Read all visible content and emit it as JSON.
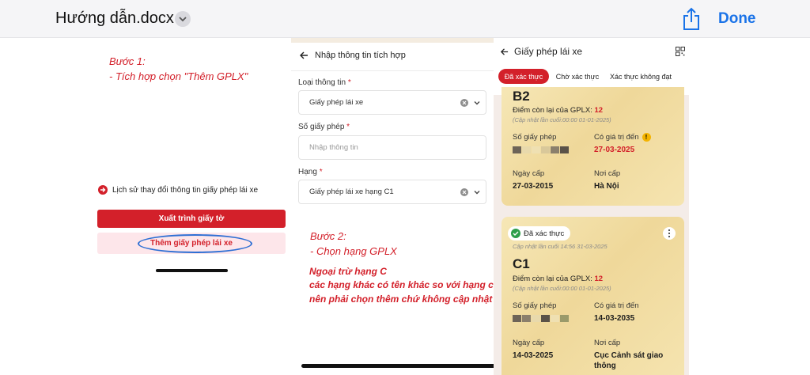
{
  "topbar": {
    "doc_title": "Hướng dẫn.docx",
    "done_label": "Done"
  },
  "left": {
    "step1_title": "Bước 1:",
    "step1_desc": "- Tích hợp chọn \"Thêm GPLX\"",
    "history_label": "Lịch sử thay đổi thông tin giấy phép lái xe",
    "export_button": "Xuất trình giấy tờ",
    "add_button": "Thêm giấy phép lái xe"
  },
  "middle": {
    "header_title": "Nhập thông tin tích hợp",
    "fields": [
      {
        "label": "Loại thông tin",
        "value": "Giấy phép lái xe",
        "placeholder": ""
      },
      {
        "label": "Số giấy phép",
        "value": "",
        "placeholder": "Nhập thông tin"
      },
      {
        "label": "Hạng",
        "value": "Giấy phép lái xe hạng C1",
        "placeholder": ""
      }
    ],
    "required_mark": "*",
    "step2_title": "Bước 2:",
    "step2_desc": "- Chọn hạng GPLX",
    "notes": [
      "Ngoại trừ hạng C",
      "các hạng khác có tên khác so với hạng cũ",
      "nên phải chọn thêm chứ không cập nhật"
    ]
  },
  "right": {
    "header_title": "Giấy phép lái xe",
    "tabs": [
      "Đã xác thực",
      "Chờ xác thực",
      "Xác thực không đạt"
    ],
    "cards": [
      {
        "license_class": "B2",
        "points_label": "Điểm còn lại của GPLX:",
        "points": "12",
        "updated": "(Cập nhật lần cuối:00:00 01-01-2025)",
        "number_label": "Số giấy phép",
        "valid_label": "Có giá trị đến",
        "valid_value": "27-03-2025",
        "issue_label": "Ngày cấp",
        "issue_value": "27-03-2015",
        "place_label": "Nơi cấp",
        "place_value": "Hà Nội"
      },
      {
        "badge": "Đã xác thực",
        "updated_top": "Cập nhật lần cuối 14:56 31-03-2025",
        "license_class": "C1",
        "points_label": "Điểm còn lại của GPLX:",
        "points": "12",
        "updated": "(Cập nhật lần cuối:00:00 01-01-2025)",
        "number_label": "Số giấy phép",
        "valid_label": "Có giá trị đến",
        "valid_value": "14-03-2035",
        "issue_label": "Ngày cấp",
        "issue_value": "14-03-2025",
        "place_label": "Nơi cấp",
        "place_value_1": "Cục Cảnh sát giao",
        "place_value_2": "thông"
      }
    ]
  },
  "colors": {
    "accent_red": "#d3202a",
    "link_blue": "#1a73e8",
    "annotation_blue": "#2e6fd4",
    "verified_green": "#2e9e4a"
  }
}
